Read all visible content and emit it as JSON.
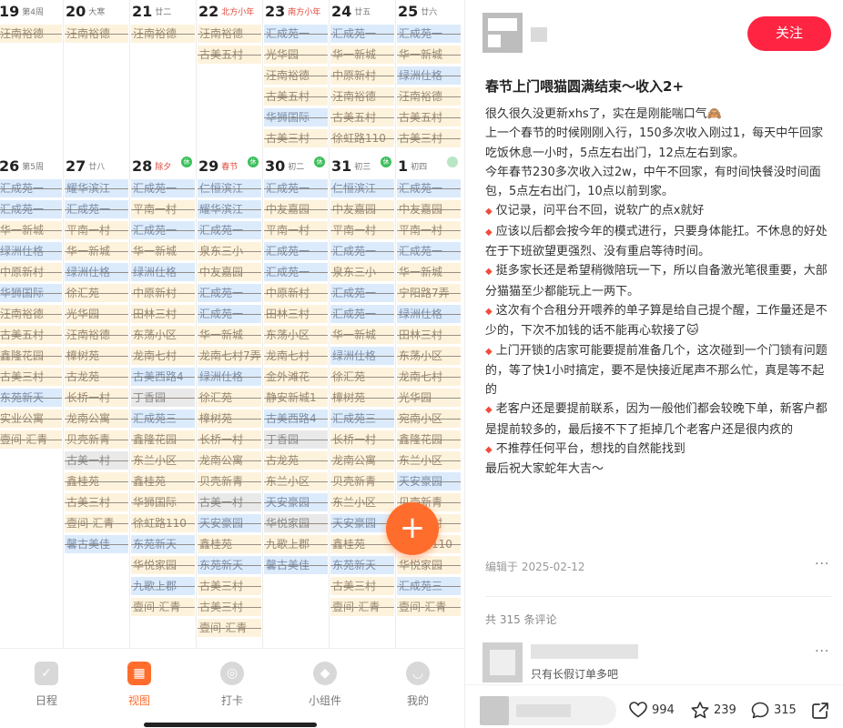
{
  "calendar": {
    "weeks": [
      {
        "days": [
          {
            "num": "19",
            "sub": "第4周",
            "sub_color": "",
            "badge": "",
            "events": [
              {
                "t": "汪南裕德",
                "c": "y"
              }
            ]
          },
          {
            "num": "20",
            "sub": "大寒",
            "sub_color": "",
            "badge": "",
            "events": [
              {
                "t": "汪南裕德",
                "c": "y"
              }
            ]
          },
          {
            "num": "21",
            "sub": "廿二",
            "sub_color": "",
            "badge": "",
            "events": [
              {
                "t": "汪南裕德",
                "c": "y"
              }
            ]
          },
          {
            "num": "22",
            "sub": "北方小年",
            "sub_color": "red",
            "badge": "",
            "events": [
              {
                "t": "汪南裕德",
                "c": "y"
              },
              {
                "t": "古美五村",
                "c": "y"
              }
            ]
          },
          {
            "num": "23",
            "sub": "南方小年",
            "sub_color": "red",
            "badge": "",
            "events": [
              {
                "t": "汇成苑一",
                "c": "b"
              },
              {
                "t": "光华园",
                "c": "y"
              },
              {
                "t": "汪南裕德",
                "c": "y"
              },
              {
                "t": "古美五村",
                "c": "y"
              },
              {
                "t": "华狮国际",
                "c": "b"
              },
              {
                "t": "古美三村",
                "c": "y"
              }
            ]
          },
          {
            "num": "24",
            "sub": "廿五",
            "sub_color": "",
            "badge": "",
            "events": [
              {
                "t": "汇成苑一",
                "c": "b"
              },
              {
                "t": "华一新城",
                "c": "y"
              },
              {
                "t": "中原新村",
                "c": "y"
              },
              {
                "t": "汪南裕德",
                "c": "y"
              },
              {
                "t": "古美五村",
                "c": "y"
              },
              {
                "t": "徐虹路110",
                "c": "y"
              }
            ]
          },
          {
            "num": "25",
            "sub": "廿六",
            "sub_color": "",
            "badge": "",
            "events": [
              {
                "t": "汇成苑一",
                "c": "b"
              },
              {
                "t": "华一新城",
                "c": "y"
              },
              {
                "t": "绿洲仕格",
                "c": "b"
              },
              {
                "t": "汪南裕德",
                "c": "y"
              },
              {
                "t": "古美五村",
                "c": "y"
              },
              {
                "t": "古美三村",
                "c": "y"
              }
            ]
          }
        ]
      },
      {
        "days": [
          {
            "num": "26",
            "sub": "第5周",
            "sub_color": "",
            "badge": "",
            "events": [
              {
                "t": "汇成苑一",
                "c": "b"
              },
              {
                "t": "汇成苑一",
                "c": "b"
              },
              {
                "t": "华一新城",
                "c": "y"
              },
              {
                "t": "绿洲仕格",
                "c": "b"
              },
              {
                "t": "中原新村",
                "c": "y"
              },
              {
                "t": "华狮国际",
                "c": "b"
              },
              {
                "t": "汪南裕德",
                "c": "y"
              },
              {
                "t": "古美五村",
                "c": "y"
              },
              {
                "t": "鑫隆花园",
                "c": "y"
              },
              {
                "t": "古美三村",
                "c": "y"
              },
              {
                "t": "东苑新天",
                "c": "b"
              },
              {
                "t": "实业公寓",
                "c": "y"
              },
              {
                "t": "壹间-汇青",
                "c": "y"
              }
            ]
          },
          {
            "num": "27",
            "sub": "廿八",
            "sub_color": "",
            "badge": "",
            "events": [
              {
                "t": "耀华滨江",
                "c": "b"
              },
              {
                "t": "汇成苑一",
                "c": "b"
              },
              {
                "t": "平南一村",
                "c": "y"
              },
              {
                "t": "华一新城",
                "c": "y"
              },
              {
                "t": "绿洲仕格",
                "c": "b"
              },
              {
                "t": "徐汇苑",
                "c": "y"
              },
              {
                "t": "光华园",
                "c": "y"
              },
              {
                "t": "汪南裕德",
                "c": "y"
              },
              {
                "t": "樟树苑",
                "c": "y"
              },
              {
                "t": "古龙苑",
                "c": "y"
              },
              {
                "t": "长桥一村",
                "c": "y"
              },
              {
                "t": "龙南公寓",
                "c": "y"
              },
              {
                "t": "贝壳新青",
                "c": "y"
              },
              {
                "t": "古美一村",
                "c": "g"
              },
              {
                "t": "鑫桂苑",
                "c": "y"
              },
              {
                "t": "古美三村",
                "c": "y"
              },
              {
                "t": "壹间-汇青",
                "c": "y"
              },
              {
                "t": "馨古美佳",
                "c": "b"
              }
            ]
          },
          {
            "num": "28",
            "sub": "除夕",
            "sub_color": "red",
            "badge": "on",
            "events": [
              {
                "t": "汇成苑一",
                "c": "b"
              },
              {
                "t": "平南一村",
                "c": "y"
              },
              {
                "t": "汇成苑一",
                "c": "b"
              },
              {
                "t": "华一新城",
                "c": "y"
              },
              {
                "t": "绿洲仕格",
                "c": "b"
              },
              {
                "t": "中原新村",
                "c": "y"
              },
              {
                "t": "田林三村",
                "c": "y"
              },
              {
                "t": "东荡小区",
                "c": "y"
              },
              {
                "t": "龙南七村",
                "c": "y"
              },
              {
                "t": "古美西路4",
                "c": "b"
              },
              {
                "t": "丁香园",
                "c": "g"
              },
              {
                "t": "汇成苑三",
                "c": "b"
              },
              {
                "t": "鑫隆花园",
                "c": "y"
              },
              {
                "t": "东兰小区",
                "c": "y"
              },
              {
                "t": "鑫桂苑",
                "c": "y"
              },
              {
                "t": "华狮国际",
                "c": "y"
              },
              {
                "t": "徐虹路110",
                "c": "y"
              },
              {
                "t": "东苑新天",
                "c": "b"
              },
              {
                "t": "华悦家园",
                "c": "y"
              },
              {
                "t": "九歌上郡",
                "c": "b"
              },
              {
                "t": "壹间-汇青",
                "c": "y"
              }
            ]
          },
          {
            "num": "29",
            "sub": "春节",
            "sub_color": "red",
            "badge": "on",
            "events": [
              {
                "t": "仁恒滨江",
                "c": "b"
              },
              {
                "t": "耀华滨江",
                "c": "b"
              },
              {
                "t": "汇成苑一",
                "c": "b"
              },
              {
                "t": "泉东三小",
                "c": "y"
              },
              {
                "t": "中友嘉园",
                "c": "y"
              },
              {
                "t": "汇成苑一",
                "c": "b"
              },
              {
                "t": "汇成苑一",
                "c": "b"
              },
              {
                "t": "华一新城",
                "c": "y"
              },
              {
                "t": "龙南七村7弄",
                "c": "y"
              },
              {
                "t": "绿洲仕格",
                "c": "b"
              },
              {
                "t": "徐汇苑",
                "c": "y"
              },
              {
                "t": "樟树苑",
                "c": "y"
              },
              {
                "t": "长桥一村",
                "c": "y"
              },
              {
                "t": "龙南公寓",
                "c": "y"
              },
              {
                "t": "贝壳新青",
                "c": "y"
              },
              {
                "t": "古美一村",
                "c": "g"
              },
              {
                "t": "天安豪园",
                "c": "b"
              },
              {
                "t": "鑫桂苑",
                "c": "y"
              },
              {
                "t": "东苑新天",
                "c": "b"
              },
              {
                "t": "古美三村",
                "c": "y"
              },
              {
                "t": "古美三村",
                "c": "y"
              },
              {
                "t": "壹间-汇青",
                "c": "y"
              }
            ]
          },
          {
            "num": "30",
            "sub": "初二",
            "sub_color": "",
            "badge": "on",
            "events": [
              {
                "t": "汇成苑一",
                "c": "b"
              },
              {
                "t": "中友嘉园",
                "c": "y"
              },
              {
                "t": "平南一村",
                "c": "y"
              },
              {
                "t": "汇成苑一",
                "c": "b"
              },
              {
                "t": "汇成苑一",
                "c": "b"
              },
              {
                "t": "中原新村",
                "c": "y"
              },
              {
                "t": "田林三村",
                "c": "y"
              },
              {
                "t": "东荡小区",
                "c": "y"
              },
              {
                "t": "龙南七村",
                "c": "y"
              },
              {
                "t": "金外滩花",
                "c": "y"
              },
              {
                "t": "静安新城1",
                "c": "y"
              },
              {
                "t": "古美西路4",
                "c": "b"
              },
              {
                "t": "丁香园",
                "c": "g"
              },
              {
                "t": "古龙苑",
                "c": "y"
              },
              {
                "t": "东兰小区",
                "c": "y"
              },
              {
                "t": "天安豪园",
                "c": "b"
              },
              {
                "t": "华悦家园",
                "c": "g"
              },
              {
                "t": "九歌上郡",
                "c": "y"
              },
              {
                "t": "馨古美佳",
                "c": "b"
              }
            ]
          },
          {
            "num": "31",
            "sub": "初三",
            "sub_color": "",
            "badge": "on",
            "events": [
              {
                "t": "仁恒滨江",
                "c": "b"
              },
              {
                "t": "中友嘉园",
                "c": "y"
              },
              {
                "t": "平南一村",
                "c": "y"
              },
              {
                "t": "汇成苑一",
                "c": "b"
              },
              {
                "t": "泉东三小",
                "c": "y"
              },
              {
                "t": "汇成苑一",
                "c": "b"
              },
              {
                "t": "汇成苑一",
                "c": "b"
              },
              {
                "t": "华一新城",
                "c": "y"
              },
              {
                "t": "绿洲仕格",
                "c": "b"
              },
              {
                "t": "徐汇苑",
                "c": "y"
              },
              {
                "t": "樟树苑",
                "c": "y"
              },
              {
                "t": "汇成苑三",
                "c": "b"
              },
              {
                "t": "长桥一村",
                "c": "y"
              },
              {
                "t": "龙南公寓",
                "c": "y"
              },
              {
                "t": "贝壳新青",
                "c": "y"
              },
              {
                "t": "东兰小区",
                "c": "y"
              },
              {
                "t": "天安豪园",
                "c": "b"
              },
              {
                "t": "鑫桂苑",
                "c": "y"
              },
              {
                "t": "东苑新天",
                "c": "b"
              },
              {
                "t": "古美三村",
                "c": "y"
              },
              {
                "t": "壹间-汇青",
                "c": "y"
              }
            ]
          },
          {
            "num": "1",
            "sub": "初四",
            "sub_color": "",
            "badge": "off",
            "events": [
              {
                "t": "汇成苑一",
                "c": "b"
              },
              {
                "t": "中友嘉园",
                "c": "y"
              },
              {
                "t": "平南一村",
                "c": "y"
              },
              {
                "t": "汇成苑一",
                "c": "b"
              },
              {
                "t": "华一新城",
                "c": "y"
              },
              {
                "t": "宁阳路7弄",
                "c": "y"
              },
              {
                "t": "绿洲仕格",
                "c": "b"
              },
              {
                "t": "田林三村",
                "c": "y"
              },
              {
                "t": "东荡小区",
                "c": "y"
              },
              {
                "t": "龙南七村",
                "c": "y"
              },
              {
                "t": "光华园",
                "c": "y"
              },
              {
                "t": "宛南小区",
                "c": "y"
              },
              {
                "t": "鑫隆花园",
                "c": "y"
              },
              {
                "t": "东兰小区",
                "c": "y"
              },
              {
                "t": "天安豪园",
                "c": "b"
              },
              {
                "t": "贝壳新青",
                "c": "y"
              },
              {
                "t": "古美三村",
                "c": "y"
              },
              {
                "t": "徐虹路110",
                "c": "y"
              },
              {
                "t": "华悦家园",
                "c": "y"
              },
              {
                "t": "汇成苑三",
                "c": "b"
              },
              {
                "t": "壹间-汇青",
                "c": "y"
              }
            ]
          }
        ]
      }
    ],
    "fab": "+",
    "nav": [
      {
        "label": "日程",
        "icon": "calendar-check-icon",
        "active": false
      },
      {
        "label": "视图",
        "icon": "view-grid-icon",
        "active": true
      },
      {
        "label": "打卡",
        "icon": "target-icon",
        "active": false
      },
      {
        "label": "小组件",
        "icon": "widget-cube-icon",
        "active": false
      },
      {
        "label": "我的",
        "icon": "profile-face-icon",
        "active": false
      }
    ]
  },
  "post": {
    "follow_label": "关注",
    "title": "春节上门喂猫圆满结束～收入2+",
    "paragraphs": [
      {
        "bullet": false,
        "text": "很久很久没更新xhs了，实在是刚能喘口气🙈"
      },
      {
        "bullet": false,
        "text": "上一个春节的时候刚刚入行，150多次收入刚过1，每天中午回家吃饭休息一小时，5点左右出门，12点左右到家。"
      },
      {
        "bullet": false,
        "text": "今年春节230多次收入过2w，中午不回家，有时间快餐没时间面包，5点左右出门，10点以前到家。"
      },
      {
        "bullet": true,
        "text": "仅记录，问平台不回，说软广的点x就好"
      },
      {
        "bullet": true,
        "text": "应该以后都会按今年的模式进行，只要身体能扛。不休息的好处在于下班欲望更强烈、没有重启等待时间。"
      },
      {
        "bullet": true,
        "text": "挺多家长还是希望稍微陪玩一下，所以自备激光笔很重要，大部分猫猫至少都能玩上一两下。"
      },
      {
        "bullet": true,
        "text": "这次有个合租分开喂养的单子算是给自己提个醒，工作量还是不少的，下次不加钱的话不能再心软接了🐱"
      },
      {
        "bullet": true,
        "text": "上门开锁的店家可能要提前准备几个，这次碰到一个门锁有问题的，等了快1小时搞定，要不是快接近尾声不那么忙，真是等不起的"
      },
      {
        "bullet": true,
        "text": "老客户还是要提前联系，因为一般他们都会较晚下单，新客户都是提前较多的，最后接不下了拒掉几个老客户还是很内疚的"
      },
      {
        "bullet": true,
        "text": "不推荐任何平台，想找的自然能找到"
      },
      {
        "bullet": false,
        "text": "最后祝大家蛇年大吉～"
      }
    ],
    "edited": "编辑于 2025-02-12",
    "comment_count": "共 315 条评论",
    "comment_text": "只有长假订单多吧",
    "likes": "994",
    "favorites": "239",
    "comments": "315",
    "colors": {
      "accent": "#ff2442",
      "bullet": "#ef4d3c"
    }
  }
}
